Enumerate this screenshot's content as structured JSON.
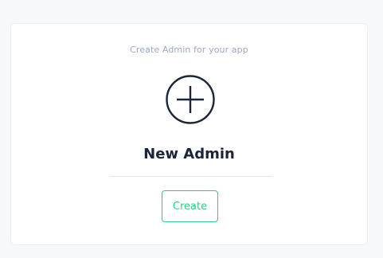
{
  "card": {
    "subtitle": "Create Admin for your app",
    "icon": "plus-circle-icon",
    "title": "New Admin",
    "button_label": "Create"
  },
  "colors": {
    "background": "#f7f8fa",
    "card": "#ffffff",
    "subtitle": "#9aa8c2",
    "title": "#1b2438",
    "accent": "#2ecc85",
    "divider": "#e3e7ee"
  }
}
